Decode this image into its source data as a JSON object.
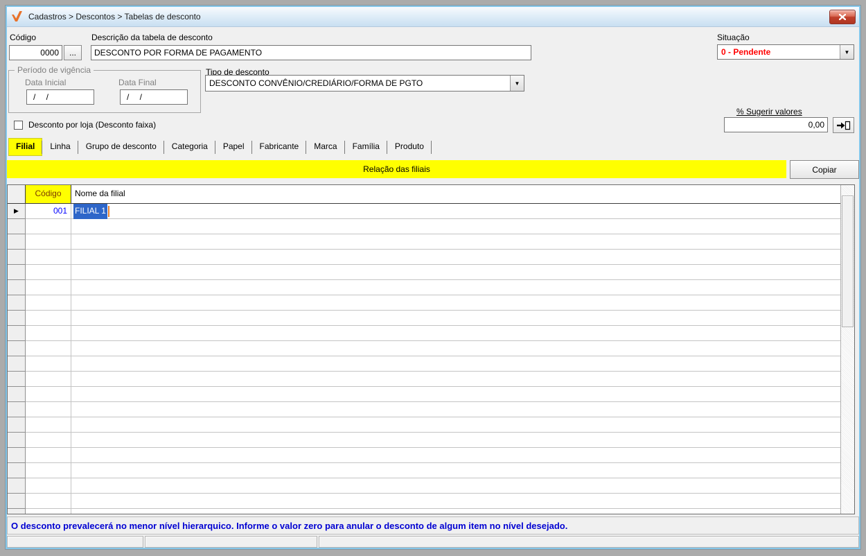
{
  "window": {
    "title": "Cadastros > Descontos > Tabelas de desconto"
  },
  "header": {
    "codigo_label": "Código",
    "codigo_value": "0000",
    "browse_button_label": "...",
    "descricao_label": "Descrição da tabela de desconto",
    "descricao_value": "DESCONTO POR FORMA DE PAGAMENTO",
    "situacao_label": "Situação",
    "situacao_value": "0 - Pendente"
  },
  "periodo": {
    "group_label": "Período de vigência",
    "data_inicial_label": "Data Inicial",
    "data_inicial_value": "/ /",
    "data_final_label": "Data Final",
    "data_final_value": "/ /"
  },
  "tipo_desconto": {
    "label": "Tipo de desconto",
    "value": "DESCONTO CONVÊNIO/CREDIÁRIO/FORMA DE PGTO"
  },
  "sugerir": {
    "label": "% Sugerir valores",
    "value": "0,00"
  },
  "loja_checkbox": {
    "label": "Desconto por loja (Desconto faixa)",
    "checked": false
  },
  "tabs": [
    {
      "label": "Filial",
      "active": true
    },
    {
      "label": "Linha",
      "active": false
    },
    {
      "label": "Grupo de desconto",
      "active": false
    },
    {
      "label": "Categoria",
      "active": false
    },
    {
      "label": "Papel",
      "active": false
    },
    {
      "label": "Fabricante",
      "active": false
    },
    {
      "label": "Marca",
      "active": false
    },
    {
      "label": "Família",
      "active": false
    },
    {
      "label": "Produto",
      "active": false
    }
  ],
  "banner": {
    "title": "Relação das filiais",
    "copy_button_label": "Copiar"
  },
  "grid": {
    "columns": [
      "Código",
      "Nome da filial"
    ],
    "rows": [
      {
        "codigo": "001",
        "nome": "FILIAL 1",
        "selected": true
      }
    ],
    "empty_rows": 20
  },
  "footer_message": "O desconto prevalecerá no menor nível hierarquico. Informe o valor zero para anular o desconto de algum item no nível desejado.",
  "status_bar": {
    "panels": [
      "",
      "",
      ""
    ]
  },
  "colors": {
    "accent_yellow": "#ffff00",
    "status_red": "#ff0000",
    "code_blue": "#0000ff",
    "selection_blue": "#2e66c9",
    "header_maroon": "#7b3a00",
    "message_blue": "#0000d2",
    "brand_orange": "#e8732c",
    "titlebar_blue": "#cde1f2",
    "window_border_blue": "#84c7ea"
  }
}
